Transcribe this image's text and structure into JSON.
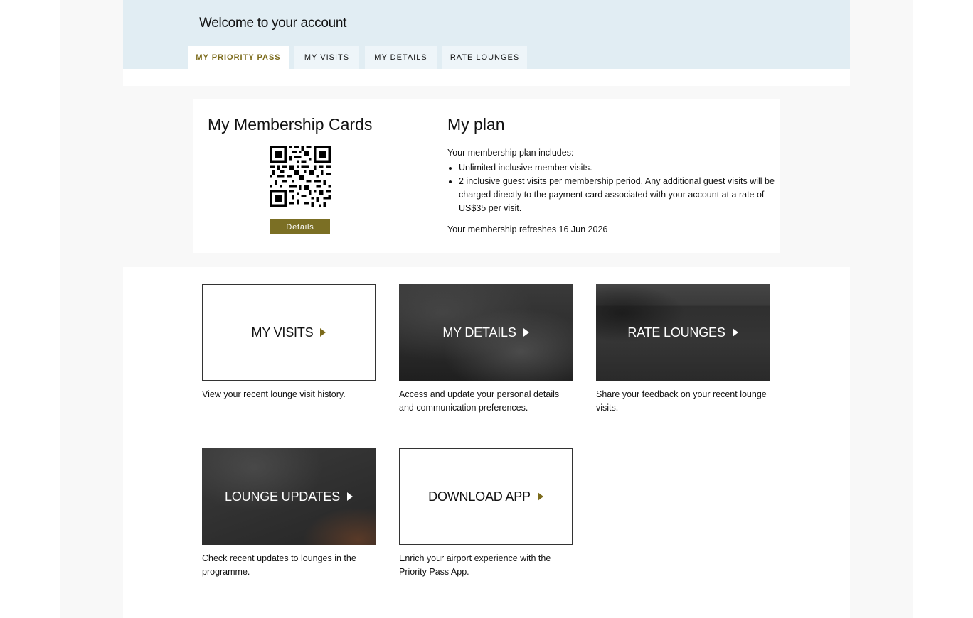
{
  "header": {
    "welcome": "Welcome to your account",
    "tabs": [
      {
        "label": "MY PRIORITY PASS",
        "active": true
      },
      {
        "label": "MY VISITS",
        "active": false
      },
      {
        "label": "MY DETAILS",
        "active": false
      },
      {
        "label": "RATE LOUNGES",
        "active": false
      }
    ]
  },
  "membership": {
    "title": "My Membership Cards",
    "details_button": "Details"
  },
  "plan": {
    "title": "My plan",
    "intro": "Your membership plan includes:",
    "items": [
      "Unlimited inclusive member visits.",
      "2 inclusive guest visits per membership period. Any additional guest visits will be charged directly to the payment card associated with your account at a rate of US$35 per visit."
    ],
    "refresh": "Your membership refreshes 16 Jun 2026"
  },
  "tiles": [
    {
      "label": "MY VISITS",
      "description": "View your recent lounge visit history."
    },
    {
      "label": "MY DETAILS",
      "description": "Access and update your personal details and communication preferences."
    },
    {
      "label": "RATE LOUNGES",
      "description": "Share your feedback on your recent lounge visits."
    },
    {
      "label": "LOUNGE UPDATES",
      "description": "Check recent updates to lounges in the programme."
    },
    {
      "label": "DOWNLOAD APP",
      "description": "Enrich your airport experience with the Priority Pass App."
    }
  ],
  "colors": {
    "accent": "#7b6f24",
    "header_bg": "#e1edf3"
  }
}
